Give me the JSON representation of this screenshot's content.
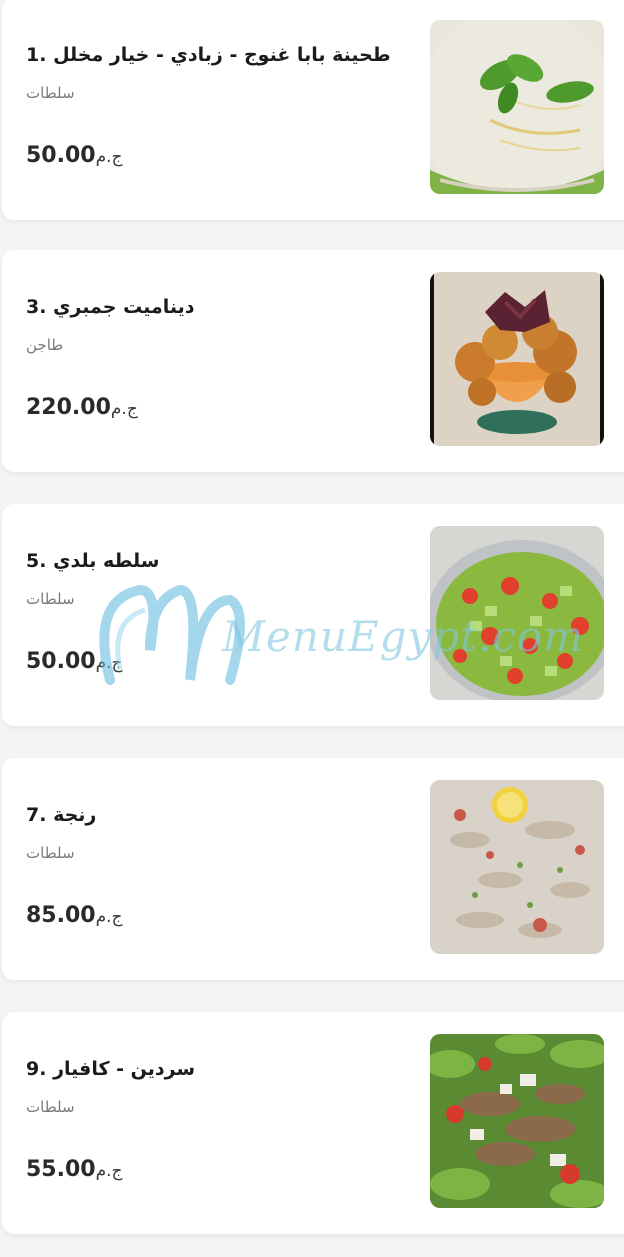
{
  "items": [
    {
      "title": "طحينة بابا غنوج - زبادي - خيار مخلل .1",
      "category": "سلطات",
      "price": "50.00",
      "currency": "ج.م",
      "image": "yogurt-dip-image"
    },
    {
      "title": "ديناميت جمبري .3",
      "category": "طاجن",
      "price": "220.00",
      "currency": "ج.م",
      "image": "shrimp-dynamite-image"
    },
    {
      "title": "سلطه بلدي .5",
      "category": "سلطات",
      "price": "50.00",
      "currency": "ج.م",
      "image": "baladi-salad-image"
    },
    {
      "title": "رنجة .7",
      "category": "سلطات",
      "price": "85.00",
      "currency": "ج.م",
      "image": "herring-image"
    },
    {
      "title": "سردين - كافيار .9",
      "category": "سلطات",
      "price": "55.00",
      "currency": "ج.م",
      "image": "sardine-salad-image"
    }
  ],
  "watermark": {
    "text": "MenuEgypt.com",
    "color": "#7fc8e2"
  }
}
